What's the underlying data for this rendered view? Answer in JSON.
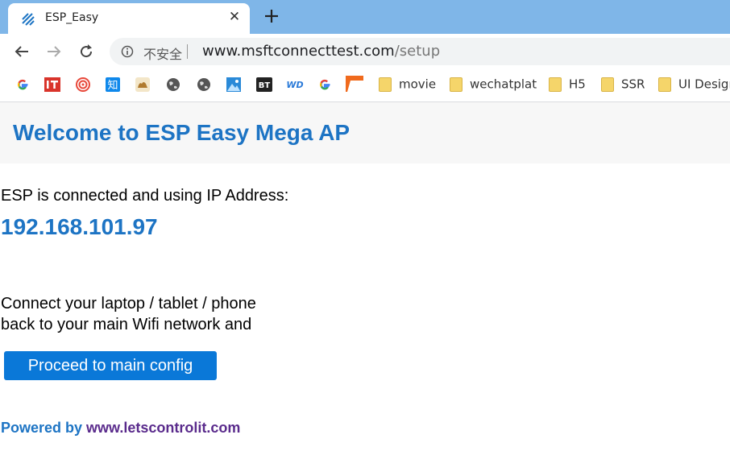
{
  "browser": {
    "tab_title": "ESP_Easy",
    "tab_close_glyph": "✕",
    "new_tab_glyph": "+",
    "security_label": "不安全",
    "url_host": "www.msftconnecttest.com",
    "url_path": "/setup",
    "tab_bar_color": "#7fb6e8"
  },
  "bookmarks": [
    {
      "type": "icon",
      "icon": "google-icon"
    },
    {
      "type": "icon",
      "icon": "it-icon"
    },
    {
      "type": "icon",
      "icon": "swirl-icon"
    },
    {
      "type": "icon",
      "icon": "zhihu-icon"
    },
    {
      "type": "icon",
      "icon": "camel-icon"
    },
    {
      "type": "icon",
      "icon": "globe-icon"
    },
    {
      "type": "icon",
      "icon": "globe-icon"
    },
    {
      "type": "icon",
      "icon": "image-icon"
    },
    {
      "type": "icon",
      "icon": "bt-icon"
    },
    {
      "type": "icon",
      "icon": "wd-icon"
    },
    {
      "type": "icon",
      "icon": "google-icon"
    },
    {
      "type": "icon",
      "icon": "flag-icon"
    },
    {
      "type": "folder",
      "label": "movie"
    },
    {
      "type": "folder",
      "label": "wechatplat"
    },
    {
      "type": "folder",
      "label": "H5"
    },
    {
      "type": "folder",
      "label": "SSR"
    },
    {
      "type": "folder",
      "label": "UI Design"
    }
  ],
  "page": {
    "title": "Welcome to ESP Easy Mega AP",
    "connected_text": "ESP is connected and using IP Address:",
    "ip_address": "192.168.101.97",
    "instruction_line1": "Connect your laptop / tablet / phone",
    "instruction_line2": "back to your main Wifi network and",
    "button_label": "Proceed to main config",
    "footer_powered": "Powered by ",
    "footer_link": "www.letscontrolit.com",
    "accent_color": "#1d74c4",
    "button_color": "#0a78d8"
  }
}
